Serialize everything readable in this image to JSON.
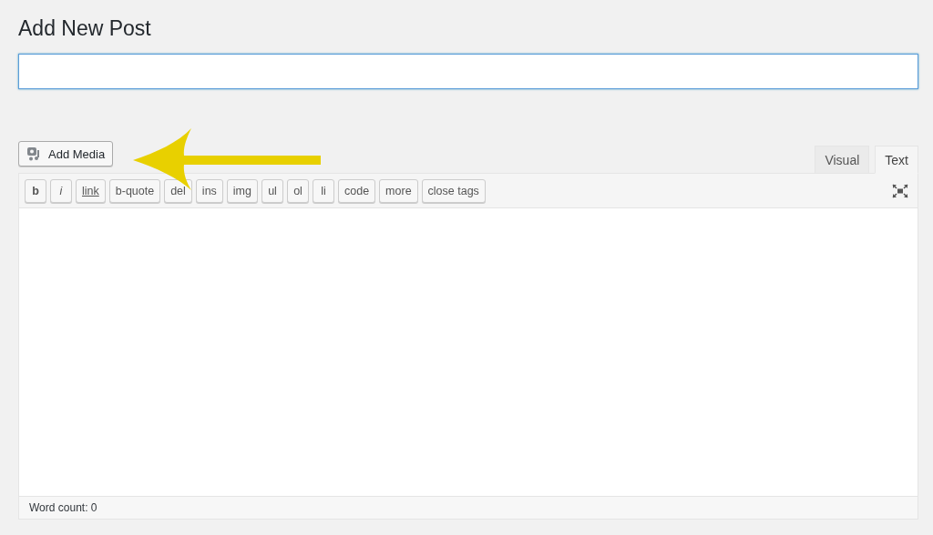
{
  "heading": "Add New Post",
  "add_media": {
    "label": "Add Media"
  },
  "editor_tabs": [
    {
      "label": "Visual",
      "selected": false
    },
    {
      "label": "Text",
      "selected": true
    }
  ],
  "quicktags": [
    {
      "label": "b",
      "kind": "bold"
    },
    {
      "label": "i",
      "kind": "italic"
    },
    {
      "label": "link",
      "kind": "link"
    },
    {
      "label": "b-quote",
      "kind": "plain"
    },
    {
      "label": "del",
      "kind": "plain"
    },
    {
      "label": "ins",
      "kind": "plain"
    },
    {
      "label": "img",
      "kind": "plain"
    },
    {
      "label": "ul",
      "kind": "plain"
    },
    {
      "label": "ol",
      "kind": "plain"
    },
    {
      "label": "li",
      "kind": "plain"
    },
    {
      "label": "code",
      "kind": "plain"
    },
    {
      "label": "more",
      "kind": "plain"
    },
    {
      "label": "close tags",
      "kind": "plain"
    }
  ],
  "status_bar": {
    "word_count": "Word count: 0"
  }
}
